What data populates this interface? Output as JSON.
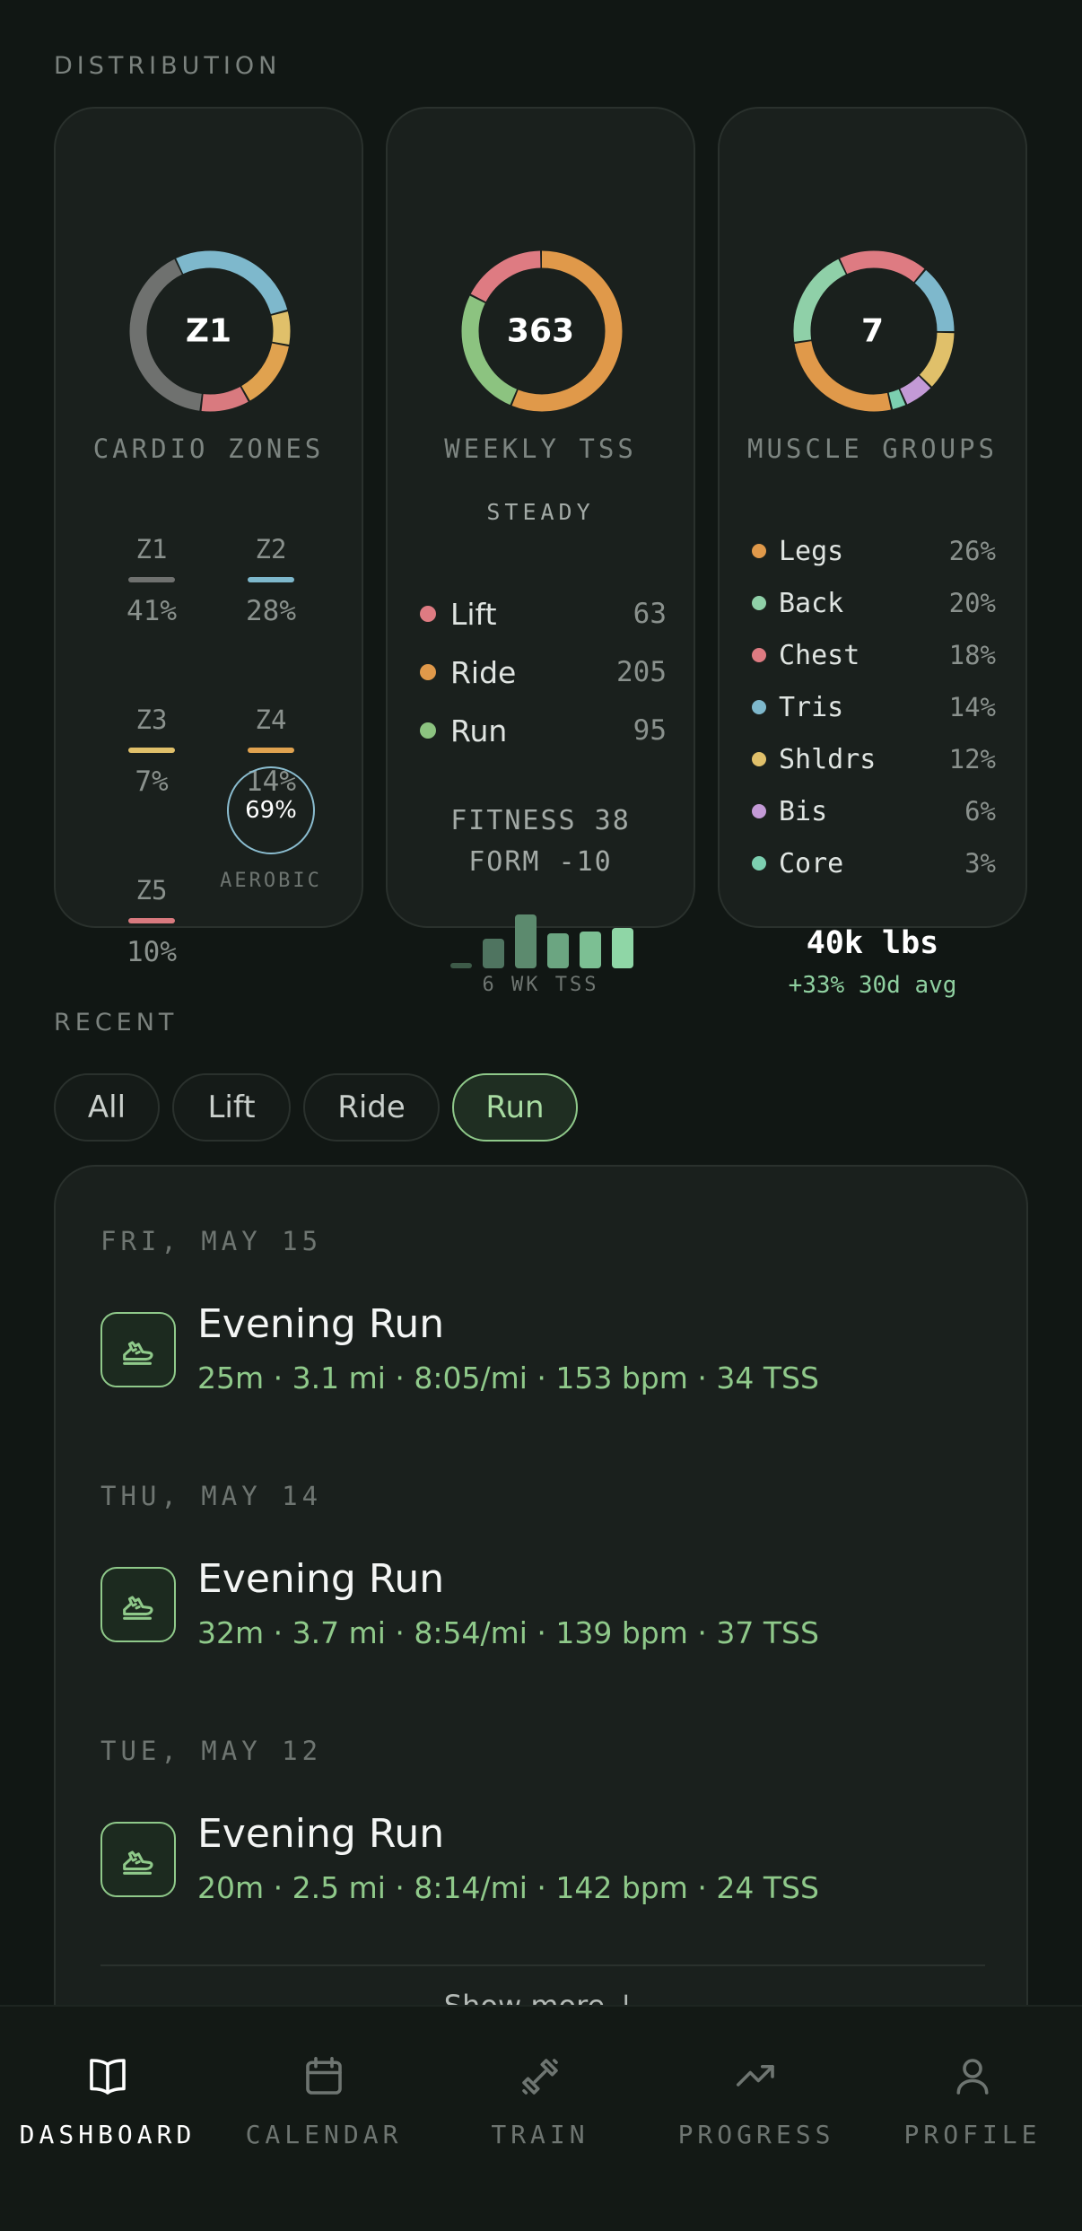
{
  "distribution": {
    "label": "DISTRIBUTION",
    "cardio": {
      "center": "Z1",
      "title": "CARDIO ZONES",
      "zones": [
        {
          "name": "Z1",
          "pct": "41%",
          "value": 41,
          "color": "#6f716f"
        },
        {
          "name": "Z2",
          "pct": "28%",
          "value": 28,
          "color": "#7eb8cc"
        },
        {
          "name": "Z3",
          "pct": "7%",
          "value": 7,
          "color": "#e0c06a"
        },
        {
          "name": "Z4",
          "pct": "14%",
          "value": 14,
          "color": "#e0a24f"
        },
        {
          "name": "Z5",
          "pct": "10%",
          "value": 10,
          "color": "#d97a7f"
        }
      ],
      "aerobic_value": "69%",
      "aerobic_label": "AEROBIC"
    },
    "tss": {
      "center": "363",
      "title": "WEEKLY TSS",
      "state": "STEADY",
      "rows": [
        {
          "label": "Lift",
          "value": "63",
          "num": 63,
          "color": "#de7b82"
        },
        {
          "label": "Ride",
          "value": "205",
          "num": 205,
          "color": "#e0994a"
        },
        {
          "label": "Run",
          "value": "95",
          "num": 95,
          "color": "#8cc380"
        }
      ],
      "fitness": "FITNESS 38",
      "form": "FORM -10",
      "weeks": [
        0.1,
        0.55,
        1.0,
        0.65,
        0.68,
        0.75
      ],
      "weeks_label": "6 WK TSS"
    },
    "muscle": {
      "center": "7",
      "title": "MUSCLE GROUPS",
      "groups": [
        {
          "label": "Legs",
          "value": "26%",
          "num": 26,
          "color": "#e0994a"
        },
        {
          "label": "Back",
          "value": "20%",
          "num": 20,
          "color": "#8fd0a8"
        },
        {
          "label": "Chest",
          "value": "18%",
          "num": 18,
          "color": "#de7b82"
        },
        {
          "label": "Tris",
          "value": "14%",
          "num": 14,
          "color": "#7eb8cc"
        },
        {
          "label": "Shldrs",
          "value": "12%",
          "num": 12,
          "color": "#e0c06a"
        },
        {
          "label": "Bis",
          "value": "6%",
          "num": 6,
          "color": "#c39ad6"
        },
        {
          "label": "Core",
          "value": "3%",
          "num": 3,
          "color": "#7ccfb0"
        }
      ],
      "volume": "40k lbs",
      "volume_sub": "+33% 30d avg"
    }
  },
  "recent": {
    "label": "RECENT",
    "filters": [
      {
        "label": "All",
        "active": false
      },
      {
        "label": "Lift",
        "active": false
      },
      {
        "label": "Ride",
        "active": false
      },
      {
        "label": "Run",
        "active": true
      }
    ],
    "activities": [
      {
        "date": "FRI, MAY 15",
        "title": "Evening Run",
        "meta": "25m · 3.1 mi · 8:05/mi · 153 bpm · 34 TSS"
      },
      {
        "date": "THU, MAY 14",
        "title": "Evening Run",
        "meta": "32m · 3.7 mi · 8:54/mi · 139 bpm · 37 TSS"
      },
      {
        "date": "TUE, MAY 12",
        "title": "Evening Run",
        "meta": "20m · 2.5 mi · 8:14/mi · 142 bpm · 24 TSS"
      }
    ],
    "show_more": "Show more ↓"
  },
  "nav": {
    "items": [
      {
        "label": "DASHBOARD",
        "icon": "book-icon",
        "active": true
      },
      {
        "label": "CALENDAR",
        "icon": "calendar-icon",
        "active": false
      },
      {
        "label": "TRAIN",
        "icon": "dumbbell-icon",
        "active": false
      },
      {
        "label": "PROGRESS",
        "icon": "trend-icon",
        "active": false
      },
      {
        "label": "PROFILE",
        "icon": "person-icon",
        "active": false
      }
    ]
  }
}
